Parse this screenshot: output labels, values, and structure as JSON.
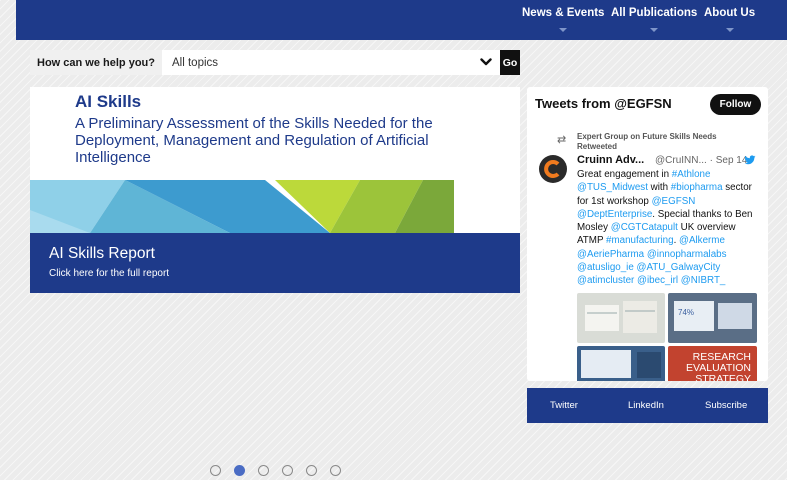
{
  "nav": {
    "items": [
      {
        "label": "News & Events"
      },
      {
        "label": "All Publications"
      },
      {
        "label": "About Us"
      }
    ]
  },
  "search": {
    "label": "How can we help you?",
    "topic": "All topics",
    "go": "Go"
  },
  "hero": {
    "title": "AI Skills",
    "subtitle": "A Preliminary Assessment of the Skills Needed for the Deployment, Management and Regulation of Artificial Intelligence",
    "caption_title": "AI Skills Report",
    "caption_sub": "Click here for the full report"
  },
  "tweets": {
    "header": "Tweets from @EGFSN",
    "follow": "Follow",
    "retweet_note": "Expert Group on Future Skills Needs Retweeted",
    "author": "Cruinn Adv...",
    "handle_date": "@CruINN... · Sep 14",
    "body_parts": [
      {
        "t": "Great engagement in ",
        "link": false
      },
      {
        "t": "#Athlone",
        "link": true
      },
      {
        "t": " ",
        "link": false
      },
      {
        "t": "@TUS_Midwest",
        "link": true
      },
      {
        "t": " with ",
        "link": false
      },
      {
        "t": "#biopharma",
        "link": true
      },
      {
        "t": " sector for 1st workshop ",
        "link": false
      },
      {
        "t": "@EGFSN",
        "link": true
      },
      {
        "t": " ",
        "link": false
      },
      {
        "t": "@DeptEnterprise",
        "link": true
      },
      {
        "t": ". Special thanks to Ben Mosley ",
        "link": false
      },
      {
        "t": "@CGTCatapult",
        "link": true
      },
      {
        "t": " UK overview ATMP ",
        "link": false
      },
      {
        "t": "#manufacturing",
        "link": true
      },
      {
        "t": ". ",
        "link": false
      },
      {
        "t": "@Alkerme",
        "link": true
      },
      {
        "t": " ",
        "link": false
      },
      {
        "t": "@AeriePharma",
        "link": true
      },
      {
        "t": " ",
        "link": false
      },
      {
        "t": "@innopharmalabs",
        "link": true
      },
      {
        "t": " ",
        "link": false
      },
      {
        "t": "@atusligo_ie",
        "link": true
      },
      {
        "t": " ",
        "link": false
      },
      {
        "t": "@ATU_GalwayCity",
        "link": true
      },
      {
        "t": " ",
        "link": false
      },
      {
        "t": "@atimcluster",
        "link": true
      },
      {
        "t": " ",
        "link": false
      },
      {
        "t": "@ibec_irl",
        "link": true
      },
      {
        "t": " ",
        "link": false
      },
      {
        "t": "@NIBRT_",
        "link": true
      }
    ],
    "media_text": "RESEARCH EVALUATION STRATEGY"
  },
  "footer_links": [
    "Twitter",
    "LinkedIn",
    "Subscribe"
  ],
  "carousel": {
    "count": 6,
    "active_index": 1
  },
  "colors": {
    "brand_blue": "#1e3a8a",
    "link_blue": "#1d9bf0"
  }
}
